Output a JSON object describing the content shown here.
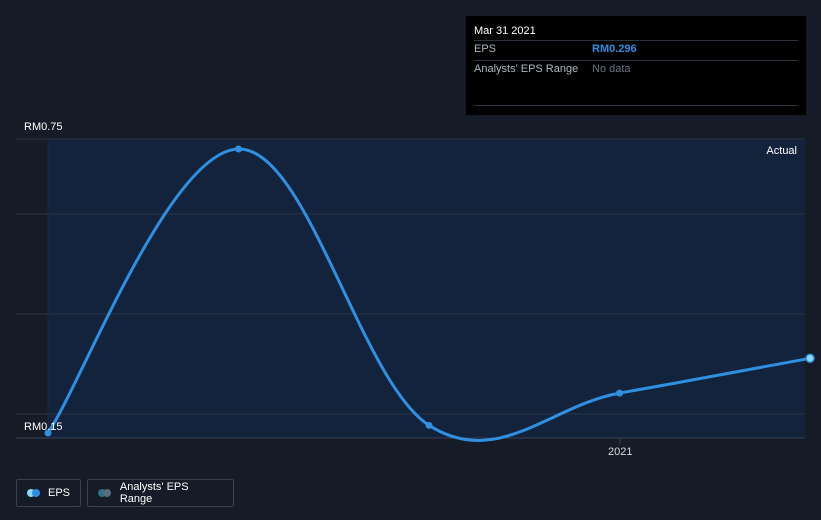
{
  "tooltip": {
    "date": "Mar 31 2021",
    "eps_label": "EPS",
    "eps_value": "RM0.296",
    "range_label": "Analysts' EPS Range",
    "range_value": "No data"
  },
  "axis": {
    "y_top_label": "RM0.75",
    "y_bottom_label": "RM0.15",
    "x_tick_label": "2021"
  },
  "region_label": "Actual",
  "legend": {
    "eps_label": "EPS",
    "range_label": "Analysts' EPS Range"
  },
  "colors": {
    "background": "#151b27",
    "plot_area": "#13233b",
    "eps_line": "#2f8fe0",
    "range_swatch": "#2e6f8a",
    "eps_swatch": "#8fd6f5"
  },
  "chart_data": {
    "type": "line",
    "series": [
      {
        "name": "EPS",
        "points": [
          {
            "x": "Mar 2019",
            "y": 0.15
          },
          {
            "x": "Sep 2019",
            "y": 0.705
          },
          {
            "x": "Mar 2020",
            "y": 0.165
          },
          {
            "x": "Sep 2020",
            "y": 0.228
          },
          {
            "x": "Mar 2021",
            "y": 0.296
          }
        ]
      }
    ],
    "ylim": [
      0.15,
      0.75
    ],
    "y_tick_labels": [
      "RM0.75",
      "RM0.15"
    ],
    "x_tick_labels": [
      "2021"
    ],
    "region": "Actual",
    "grid": true,
    "legend": "bottom-left"
  }
}
